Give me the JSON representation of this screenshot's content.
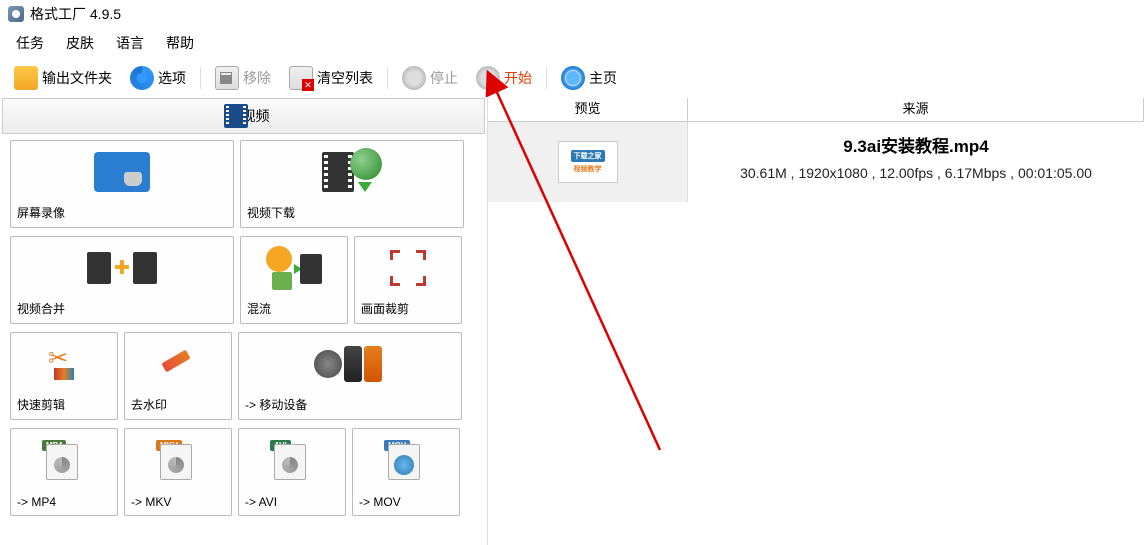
{
  "title": "格式工厂 4.9.5",
  "menu": {
    "task": "任务",
    "skin": "皮肤",
    "lang": "语言",
    "help": "帮助"
  },
  "toolbar": {
    "output": "输出文件夹",
    "options": "选项",
    "remove": "移除",
    "clear": "清空列表",
    "stop": "停止",
    "start": "开始",
    "home": "主页"
  },
  "category": "视频",
  "tiles": {
    "recorder": "屏幕录像",
    "download": "视频下载",
    "merge": "视频合并",
    "mix": "混流",
    "crop": "画面裁剪",
    "quickedit": "快速剪辑",
    "watermark": "去水印",
    "mobile": "-> 移动设备",
    "mp4": "-> MP4",
    "mkv": "-> MKV",
    "avi": "-> AVI",
    "mov": "-> MOV",
    "tag_mp4": "MP4",
    "tag_mkv": "MKV",
    "tag_avi": "AVI",
    "tag_mov": "MOV"
  },
  "columns": {
    "preview": "预览",
    "source": "来源"
  },
  "file": {
    "name": "9.3ai安装教程.mp4",
    "info": "30.61M , 1920x1080 , 12.00fps , 6.17Mbps , 00:01:05.00",
    "thumb_top": "下载之家",
    "thumb_bot": "视频教学"
  }
}
